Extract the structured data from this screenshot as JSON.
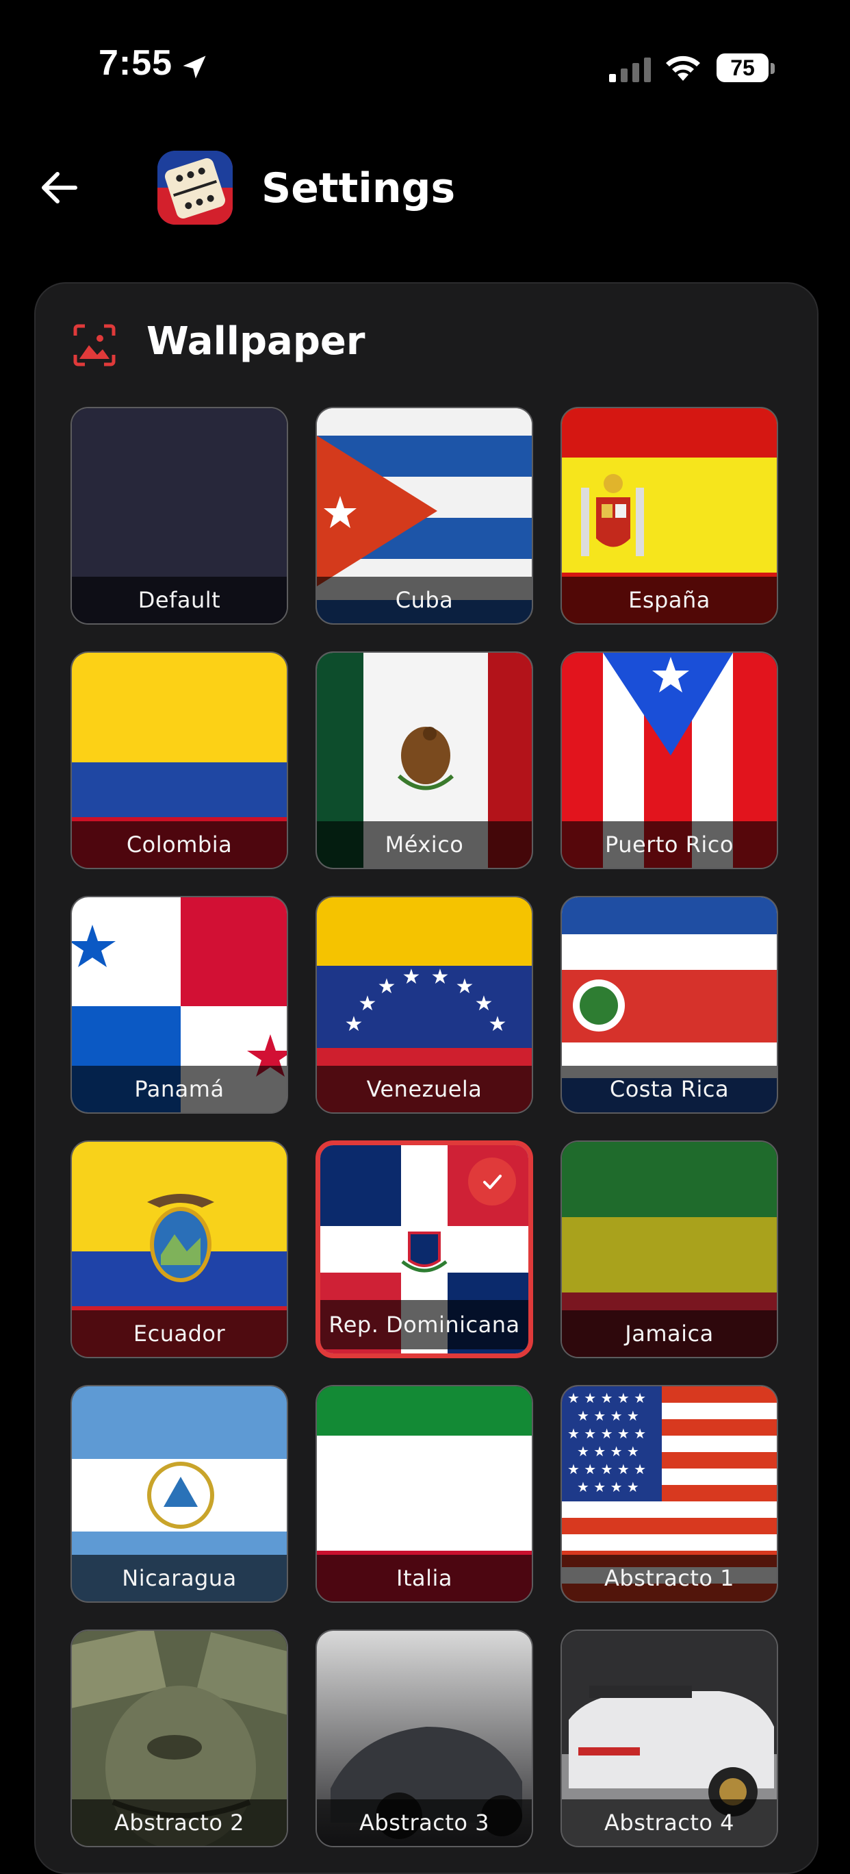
{
  "status_bar": {
    "time": "7:55",
    "battery": "75"
  },
  "header": {
    "title": "Settings"
  },
  "section": {
    "title": "Wallpaper"
  },
  "wallpapers": [
    {
      "label": "Default",
      "selected": false
    },
    {
      "label": "Cuba",
      "selected": false
    },
    {
      "label": "España",
      "selected": false
    },
    {
      "label": "Colombia",
      "selected": false
    },
    {
      "label": "México",
      "selected": false
    },
    {
      "label": "Puerto Rico",
      "selected": false
    },
    {
      "label": "Panamá",
      "selected": false
    },
    {
      "label": "Venezuela",
      "selected": false
    },
    {
      "label": "Costa Rica",
      "selected": false
    },
    {
      "label": "Ecuador",
      "selected": false
    },
    {
      "label": "Rep. Dominicana",
      "selected": true
    },
    {
      "label": "Jamaica",
      "selected": false
    },
    {
      "label": "Nicaragua",
      "selected": false
    },
    {
      "label": "Italia",
      "selected": false
    },
    {
      "label": "Abstracto 1",
      "selected": false
    },
    {
      "label": "Abstracto 2",
      "selected": false
    },
    {
      "label": "Abstracto 3",
      "selected": false
    },
    {
      "label": "Abstracto 4",
      "selected": false
    }
  ],
  "colors": {
    "accent": "#e03a3a",
    "card_bg": "#1b1b1c",
    "page_bg": "#000000"
  }
}
